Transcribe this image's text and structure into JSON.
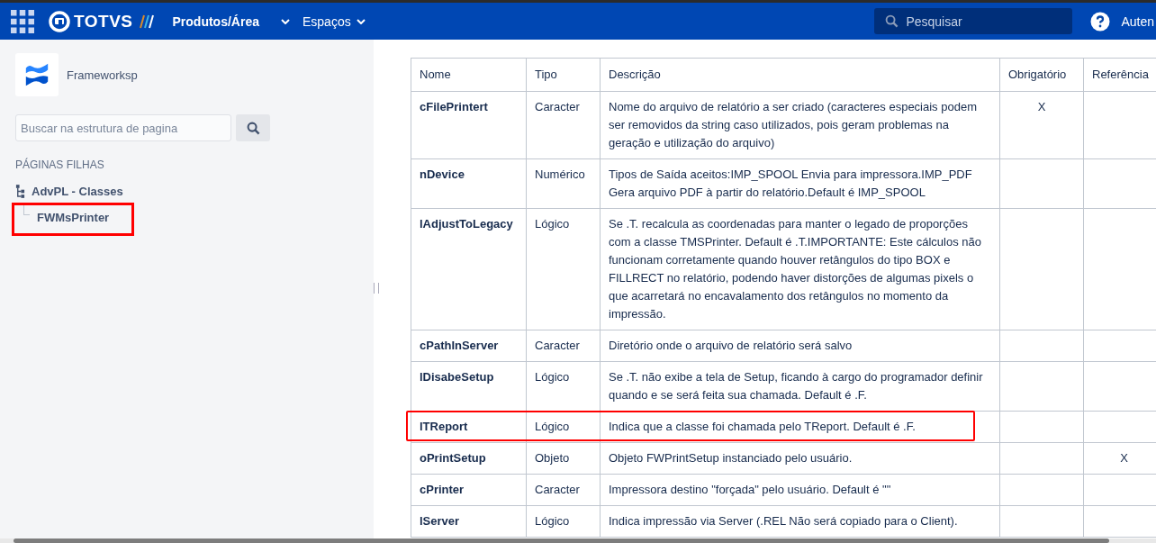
{
  "top_bar": {
    "logo": "TOTVS",
    "nav": [
      {
        "label": "Produtos/Área",
        "dropdown": true
      },
      {
        "label": "Espaços",
        "dropdown": true
      }
    ],
    "search": {
      "placeholder": "Pesquisar"
    },
    "user": "Auten"
  },
  "sidebar": {
    "space_name": "Frameworksp",
    "search": {
      "placeholder": "Buscar na estrutura de pagina"
    },
    "section_title": "PÁGINAS FILHAS",
    "tree": [
      {
        "label": "AdvPL - Classes",
        "highlighted": false,
        "children": [
          {
            "label": "FWMsPrinter",
            "highlighted": true
          }
        ]
      }
    ]
  },
  "table": {
    "columns": [
      "Nome",
      "Tipo",
      "Descrição",
      "Obrigatório",
      "Referência"
    ],
    "rows": [
      {
        "name": "cFilePrintert",
        "type": "Caracter",
        "description": "Nome do arquivo de relatório a ser criado (caracteres especiais podem ser removidos da string caso utilizados, pois geram problemas na geração e utilização do arquivo)",
        "required": "X",
        "highlighted": false
      },
      {
        "name": "nDevice",
        "type": "Numérico",
        "description": "Tipos de Saída aceitos:IMP_SPOOL Envia para impressora.IMP_PDF Gera arquivo PDF à partir do relatório.Default é IMP_SPOOL",
        "highlighted": false
      },
      {
        "name": "lAdjustToLegacy",
        "type": "Lógico",
        "description": "Se .T. recalcula as coordenadas para manter o legado de proporções com a classe TMSPrinter. Default é .T.IMPORTANTE: Este cálculos não funcionam corretamente quando houver retângulos do tipo BOX e FILLRECT no relatório, podendo haver distorções de algumas pixels o que acarretará no encavalamento dos retângulos no momento da impressão.",
        "highlighted": false
      },
      {
        "name": "cPathInServer",
        "type": "Caracter",
        "description": "Diretório onde o arquivo de relatório será salvo",
        "highlighted": false
      },
      {
        "name": "lDisabeSetup",
        "type": "Lógico",
        "description": "Se .T. não exibe a tela de Setup, ficando à cargo do programador definir quando e se será feita sua chamada. Default é .F.",
        "highlighted": false
      },
      {
        "name": "lTReport",
        "type": "Lógico",
        "description": "Indica que a classe foi chamada pelo TReport. Default é .F.",
        "highlighted": true
      },
      {
        "name": "oPrintSetup",
        "type": "Objeto",
        "description": "Objeto FWPrintSetup instanciado pelo usuário.",
        "reference": "X",
        "highlighted": false
      },
      {
        "name": "cPrinter",
        "type": "Caracter",
        "description": "Impressora destino \"forçada\" pelo usuário. Default é \"\"",
        "highlighted": false
      },
      {
        "name": "lServer",
        "type": "Lógico",
        "description": "Indica impressão via Server (.REL Não será copiado para o Client).",
        "highlighted": false
      }
    ]
  }
}
